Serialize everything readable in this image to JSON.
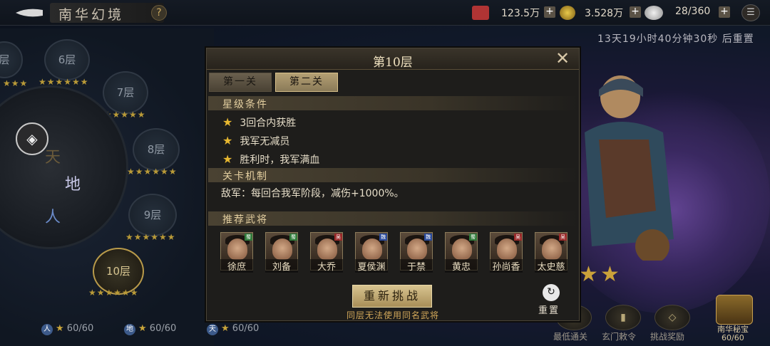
{
  "header": {
    "title": "南华幻境",
    "help_icon": "question-icon",
    "resources": [
      {
        "name": "copper-icon",
        "value": "123.5万"
      },
      {
        "name": "coin-icon",
        "value": "3.528万"
      },
      {
        "name": "stamina-icon",
        "value": "28/360"
      }
    ],
    "plus": "+",
    "menu_icon": "menu-icon"
  },
  "timer": "13天19小时40分钟30秒 后重置",
  "floors": [
    {
      "label": "6层",
      "stars": "★★★★★★"
    },
    {
      "label": "7层",
      "stars": "★★★★★★"
    },
    {
      "label": "8层",
      "stars": "★★★★★★"
    },
    {
      "label": "9层",
      "stars": "★★★★★★"
    },
    {
      "label": "10层",
      "stars": "★★★★★★"
    }
  ],
  "partial_floor": {
    "label": "层",
    "stars": "★★★"
  },
  "wheel": {
    "earth": "地",
    "human": "人",
    "heaven": "天"
  },
  "tallies": [
    {
      "badge": "人",
      "value": "60/60"
    },
    {
      "badge": "地",
      "value": "60/60"
    },
    {
      "badge": "天",
      "value": "60/60"
    }
  ],
  "dialog": {
    "title": "第10层",
    "tabs": [
      "第一关",
      "第二关"
    ],
    "section_stars": "星级条件",
    "conditions": [
      "3回合内获胜",
      "我军无减员",
      "胜利时，我军满血"
    ],
    "section_mech": "关卡机制",
    "mechanism": "敌军：每回合我军阶段，减伤+1000%。",
    "section_heroes": "推荐武将",
    "heroes": [
      {
        "name": "徐庶",
        "faction": "蜀"
      },
      {
        "name": "刘备",
        "faction": "蜀"
      },
      {
        "name": "大乔",
        "faction": "吴"
      },
      {
        "name": "夏侯渊",
        "faction": "魏"
      },
      {
        "name": "于禁",
        "faction": "魏"
      },
      {
        "name": "黄忠",
        "faction": "蜀"
      },
      {
        "name": "孙尚香",
        "faction": "吴"
      },
      {
        "name": "太史慈",
        "faction": "吴"
      }
    ],
    "retry": "重新挑战",
    "retry_note": "同层无法使用同名武将",
    "reset": "重置"
  },
  "bottom": {
    "buttons": [
      "最低通关",
      "玄门敕令",
      "挑战奖励"
    ],
    "chest_label": "南华秘宝",
    "chest_count": "60/60"
  },
  "colors": {
    "gold": "#caa23a",
    "accent": "#d8c490"
  }
}
